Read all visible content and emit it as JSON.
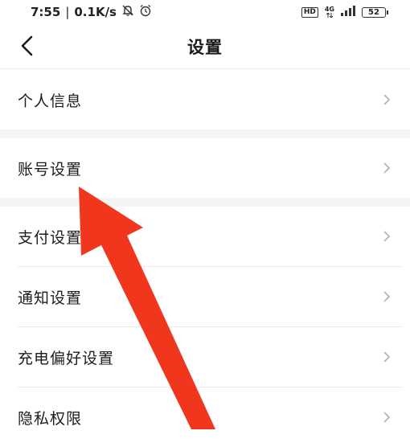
{
  "status_bar": {
    "time": "7:55",
    "separator": "|",
    "network_speed": "0.1K/s",
    "hd_label": "HD",
    "network_type": "4G",
    "battery_level": "52",
    "icons": [
      "notification-off-icon",
      "alarm-icon",
      "hd-icon",
      "signal-icon",
      "battery-icon"
    ]
  },
  "header": {
    "title": "设置",
    "back_icon": "chevron-left-icon"
  },
  "settings": {
    "items": [
      {
        "label": "个人信息"
      },
      {
        "label": "账号设置"
      },
      {
        "label": "支付设置"
      },
      {
        "label": "通知设置"
      },
      {
        "label": "充电偏好设置"
      },
      {
        "label": "隐私权限"
      }
    ]
  },
  "colors": {
    "arrow": "#f0371e",
    "separator": "#f4f4f4",
    "chevron": "#b5b5b5"
  }
}
